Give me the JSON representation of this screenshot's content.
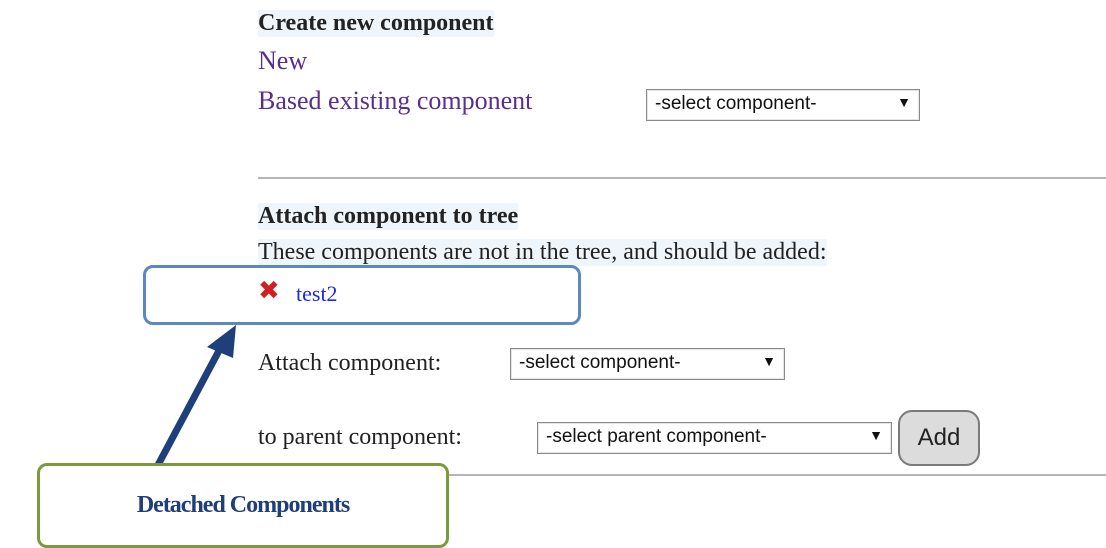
{
  "create": {
    "heading": "Create new component",
    "new_link": "New",
    "based_link": "Based existing component",
    "select_value": "-select component-"
  },
  "attach": {
    "heading": "Attach component to tree",
    "description": "These components are not in the tree, and should be added:",
    "detached_items": [
      {
        "name": "test2",
        "icon": "remove-x-icon",
        "icon_color": "#d22020"
      }
    ],
    "attach_label": "Attach component:",
    "attach_select": "-select component-",
    "parent_label": "to parent component:",
    "parent_select": "-select parent component-",
    "add_button": "Add"
  },
  "callout": {
    "label": "Detached Components"
  },
  "colors": {
    "link": "#5a2e8c",
    "item_link": "#1a2bd6",
    "callout_blue": "#5b88bf",
    "callout_green": "#7b9a3c",
    "arrow": "#1f3f7a"
  }
}
